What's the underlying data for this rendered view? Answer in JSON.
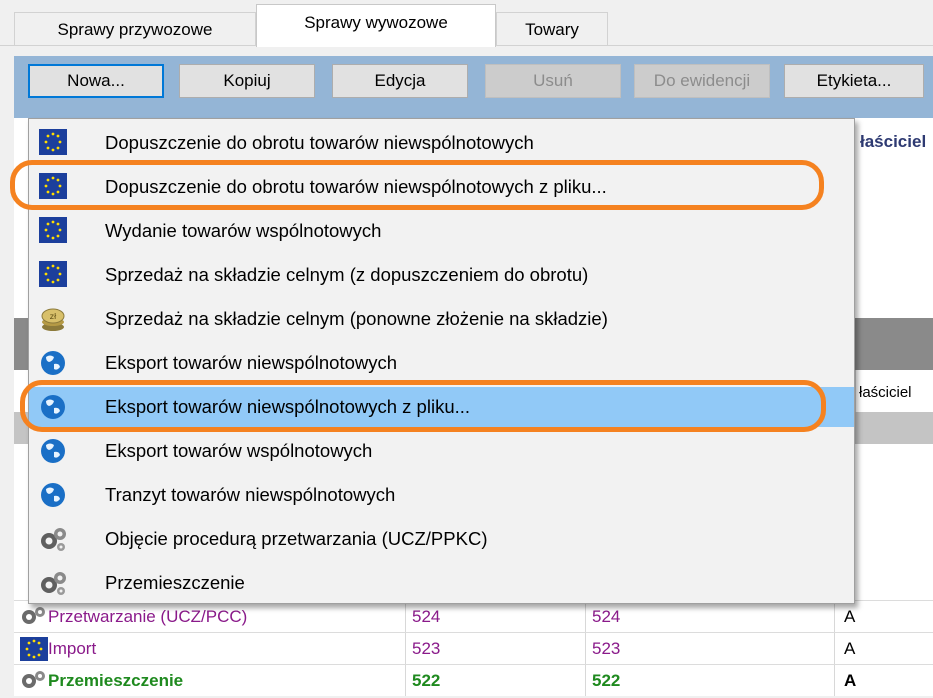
{
  "tabs": [
    {
      "label": "Sprawy przywozowe",
      "active": false
    },
    {
      "label": "Sprawy wywozowe",
      "active": true
    },
    {
      "label": "Towary",
      "active": false
    }
  ],
  "toolbar": {
    "new_label": "Nowa...",
    "copy_label": "Kopiuj",
    "edit_label": "Edycja",
    "delete_label": "Usuń",
    "register_label": "Do ewidencji",
    "label_label": "Etykieta..."
  },
  "background": {
    "owner_header": "łaściciel",
    "owner_header_small": "łaściciel",
    "rows": [
      {
        "type": "Przetwarzanie (UCZ/PCC)",
        "col2": "524",
        "col3": "524",
        "col4": "A",
        "color": "#8a1a8a",
        "bold": false,
        "icon": "gears-icon"
      },
      {
        "type": "Import",
        "col2": "523",
        "col3": "523",
        "col4": "A",
        "color": "#8a1a8a",
        "bold": false,
        "icon": "eu-flag-icon"
      },
      {
        "type": "Przemieszczenie",
        "col2": "522",
        "col3": "522",
        "col4": "A",
        "color": "#1f8a1f",
        "bold": true,
        "icon": "gears-icon"
      }
    ]
  },
  "menu": {
    "items": [
      {
        "label": "Dopuszczenie do obrotu towarów niewspólnotowych",
        "icon": "eu-flag-icon"
      },
      {
        "label": "Dopuszczenie do obrotu towarów niewspólnotowych z pliku...",
        "icon": "eu-flag-icon"
      },
      {
        "label": "Wydanie towarów wspólnotowych",
        "icon": "eu-flag-icon"
      },
      {
        "label": "Sprzedaż na składzie celnym (z dopuszczeniem do obrotu)",
        "icon": "eu-flag-icon"
      },
      {
        "label": "Sprzedaż na składzie celnym (ponowne złożenie na składzie)",
        "icon": "coins-icon"
      },
      {
        "label": "Eksport towarów niewspólnotowych",
        "icon": "globe-icon"
      },
      {
        "label": "Eksport towarów niewspólnotowych z pliku...",
        "icon": "globe-icon"
      },
      {
        "label": "Eksport towarów wspólnotowych",
        "icon": "globe-icon"
      },
      {
        "label": "Tranzyt towarów niewspólnotowych",
        "icon": "globe-icon"
      },
      {
        "label": "Objęcie procedurą przetwarzania (UCZ/PPKC)",
        "icon": "gears-icon"
      },
      {
        "label": "Przemieszczenie",
        "icon": "gears-icon"
      }
    ],
    "highlighted_index": 6
  },
  "colors": {
    "panel": "#94b5d6",
    "highlight": "#91c9f7",
    "annotation_ring": "#f58220",
    "eu_blue": "#1c3f9c",
    "eu_star": "#ffdd00"
  }
}
